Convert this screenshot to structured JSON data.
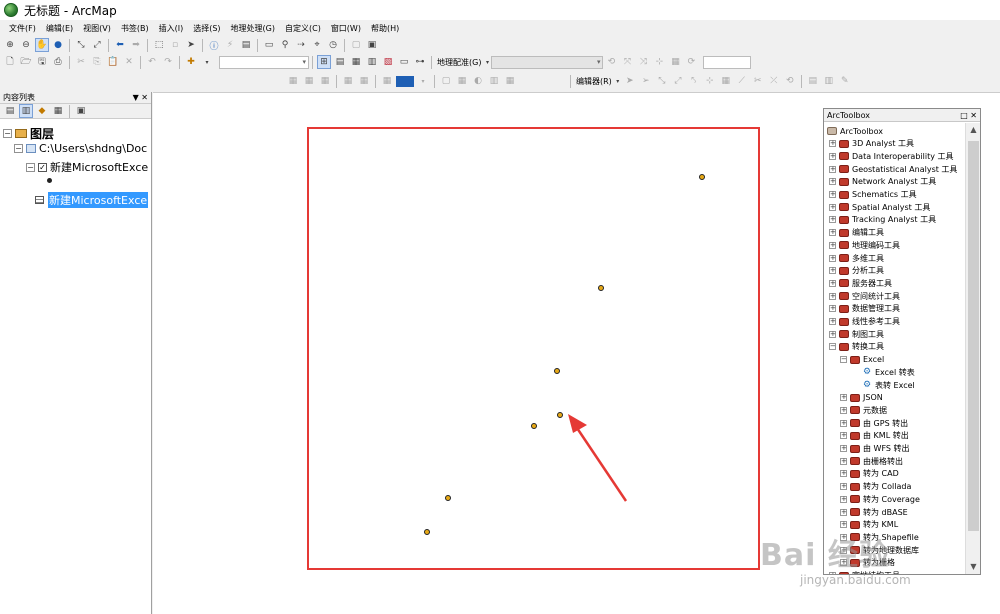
{
  "window": {
    "title": "无标题 - ArcMap"
  },
  "menubar": {
    "items": [
      "文件(F)",
      "编辑(E)",
      "视图(V)",
      "书签(B)",
      "插入(I)",
      "选择(S)",
      "地理处理(G)",
      "自定义(C)",
      "窗口(W)",
      "帮助(H)"
    ]
  },
  "toolbar": {
    "georef_label": "地理配准(G)",
    "editor_label": "编辑器(R)"
  },
  "toc": {
    "title": "内容列表",
    "pin": "▼ ✕",
    "root_label": "图层",
    "folder_label": "C:\\Users\\shdng\\Doc",
    "layer_label": "新建MicrosoftExce",
    "table_label": "新建MicrosoftExce"
  },
  "arctoolbox": {
    "title": "ArcToolbox",
    "controls": "□ ✕",
    "root": "ArcToolbox",
    "toolsets": [
      "3D Analyst 工具",
      "Data Interoperability 工具",
      "Geostatistical Analyst 工具",
      "Network Analyst 工具",
      "Schematics 工具",
      "Spatial Analyst 工具",
      "Tracking Analyst 工具",
      "编辑工具",
      "地理编码工具",
      "多维工具",
      "分析工具",
      "服务器工具",
      "空间统计工具",
      "数据管理工具",
      "线性参考工具",
      "制图工具",
      "转换工具"
    ],
    "excel_group": "Excel",
    "excel_tools": [
      "Excel 转表",
      "表转 Excel"
    ],
    "conversion_subsets": [
      "JSON",
      "元数据",
      "由 GPS 转出",
      "由 KML 转出",
      "由 WFS 转出",
      "由栅格转出",
      "转为 CAD",
      "转为 Collada",
      "转为 Coverage",
      "转为 dBASE",
      "转为 KML",
      "转为 Shapefile",
      "转为地理数据库",
      "转为栅格"
    ],
    "last_visible": "宗地结构工具"
  },
  "watermark": {
    "main": "Bai 经验",
    "sub": "jingyan.baidu.com"
  },
  "colors": {
    "frame": "#e53935",
    "point_fill": "#e6a817",
    "selection": "#3399ff",
    "toolbox_icon": "#c0392b"
  },
  "icons": [
    "arcmap-globe-icon",
    "zoom-in-icon",
    "zoom-out-icon",
    "pan-icon",
    "full-extent-icon",
    "identify-icon",
    "select-arrow-icon",
    "toolbox-icon",
    "python-icon"
  ]
}
